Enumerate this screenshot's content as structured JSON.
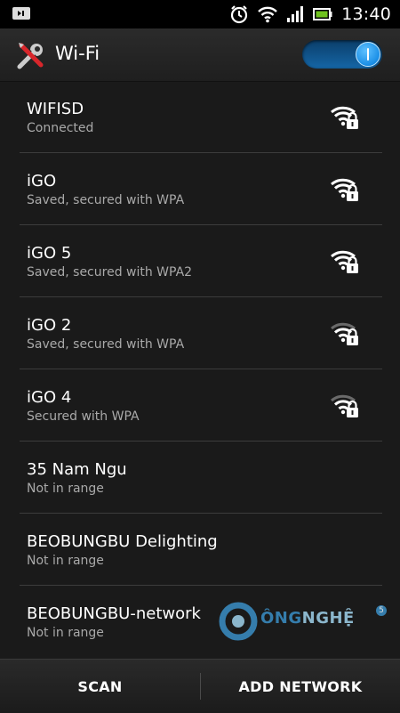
{
  "status_bar": {
    "time": "13:40",
    "icons": [
      "notification-icon",
      "alarm-icon",
      "wifi-icon",
      "signal-icon",
      "battery-icon"
    ]
  },
  "action_bar": {
    "title": "Wi-Fi",
    "toggle_state": "on",
    "settings_icon": "tools-icon"
  },
  "networks": [
    {
      "name": "WIFISD",
      "status": "Connected",
      "signal": "strong",
      "secured": true
    },
    {
      "name": "iGO",
      "status": "Saved, secured with WPA",
      "signal": "strong",
      "secured": true
    },
    {
      "name": "iGO 5",
      "status": "Saved, secured with WPA2",
      "signal": "strong",
      "secured": true
    },
    {
      "name": "iGO 2",
      "status": "Saved, secured with WPA",
      "signal": "medium",
      "secured": true
    },
    {
      "name": "iGO 4",
      "status": "Secured with WPA",
      "signal": "medium",
      "secured": true
    },
    {
      "name": "35 Nam Ngu",
      "status": "Not in range",
      "signal": "none",
      "secured": false
    },
    {
      "name": "BEOBUNGBU Delighting",
      "status": "Not in range",
      "signal": "none",
      "secured": false
    },
    {
      "name": "BEOBUNGBU-network",
      "status": "Not in range",
      "signal": "none",
      "secured": false
    }
  ],
  "bottom_bar": {
    "scan_label": "SCAN",
    "add_network_label": "ADD NETWORK"
  },
  "watermark": {
    "text_a": "C",
    "text_b": "ÔNG",
    "text_c": "NGHỆ",
    "badge": "5"
  },
  "colors": {
    "accent": "#1a8ee6",
    "background": "#1a1a1a",
    "secondary_text": "#a9a9a9"
  }
}
